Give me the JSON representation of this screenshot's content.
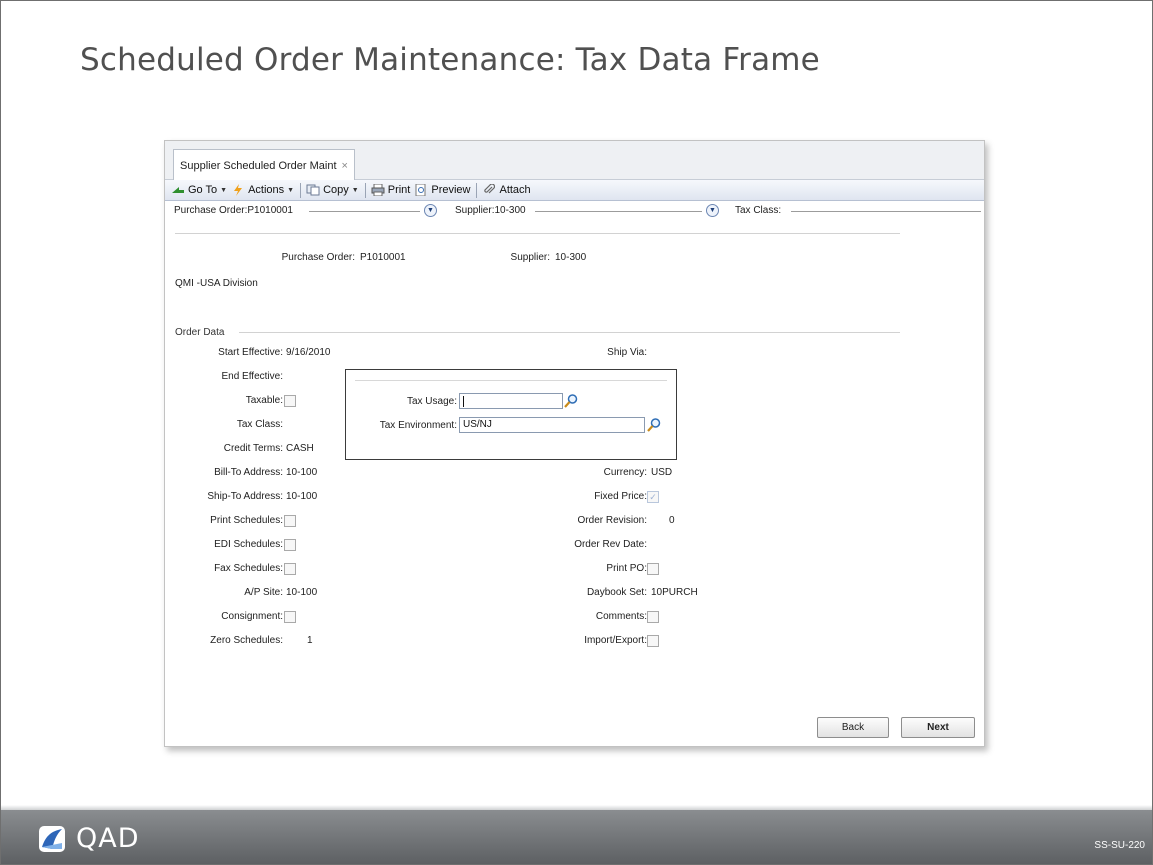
{
  "slide": {
    "title": "Scheduled Order Maintenance: Tax Data Frame",
    "code": "SS-SU-220",
    "brand": "QAD"
  },
  "window": {
    "tab_label": "Supplier Scheduled Order Maint",
    "tab_close": "×"
  },
  "toolbar": {
    "goto": "Go To",
    "actions": "Actions",
    "copy": "Copy",
    "print": "Print",
    "preview": "Preview",
    "attach": "Attach"
  },
  "summary": {
    "purchase_order": "Purchase Order:P1010001",
    "supplier": "Supplier:10-300",
    "tax_class": "Tax Class:"
  },
  "header_fields": {
    "purchase_order_label": "Purchase Order:",
    "purchase_order_value": "P1010001",
    "supplier_label": "Supplier:",
    "supplier_value": "10-300",
    "division": "QMI -USA Division"
  },
  "order_data": {
    "section_title": "Order Data",
    "left": {
      "start_effective_label": "Start Effective:",
      "start_effective_value": "9/16/2010",
      "end_effective_label": "End Effective:",
      "taxable_label": "Taxable:",
      "tax_class_label": "Tax Class:",
      "credit_terms_label": "Credit Terms:",
      "credit_terms_value": "CASH",
      "bill_to_label": "Bill-To Address:",
      "bill_to_value": "10-100",
      "ship_to_label": "Ship-To Address:",
      "ship_to_value": "10-100",
      "print_schedules_label": "Print Schedules:",
      "edi_schedules_label": "EDI Schedules:",
      "fax_schedules_label": "Fax Schedules:",
      "ap_site_label": "A/P Site:",
      "ap_site_value": "10-100",
      "consignment_label": "Consignment:",
      "zero_schedules_label": "Zero Schedules:",
      "zero_schedules_value": "1"
    },
    "right": {
      "ship_via_label": "Ship Via:",
      "currency_label": "Currency:",
      "currency_value": "USD",
      "fixed_price_label": "Fixed Price:",
      "order_revision_label": "Order Revision:",
      "order_revision_value": "0",
      "order_rev_date_label": "Order Rev Date:",
      "print_po_label": "Print PO:",
      "daybook_set_label": "Daybook Set:",
      "daybook_set_value": "10PURCH",
      "comments_label": "Comments:",
      "import_export_label": "Import/Export:"
    }
  },
  "tax_frame": {
    "tax_usage_label": "Tax Usage:",
    "tax_usage_value": "",
    "tax_environment_label": "Tax Environment:",
    "tax_environment_value": "US/NJ"
  },
  "buttons": {
    "back": "Back",
    "next": "Next"
  }
}
